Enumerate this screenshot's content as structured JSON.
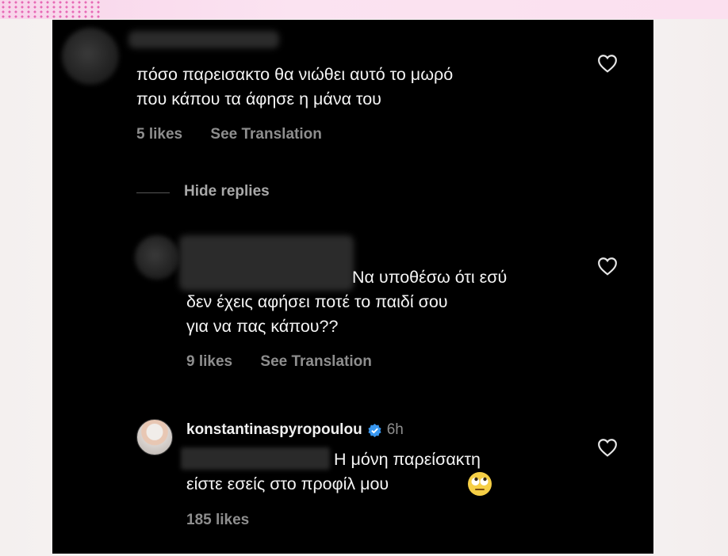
{
  "comments": [
    {
      "text_line1": "πόσο παρεισακτο θα νιώθει αυτό το μωρό",
      "text_line2": "που κάπου τα άφησε η μάνα του",
      "likes": "5 likes",
      "translate": "See Translation"
    },
    {
      "text_line1": "Να υποθέσω ότι εσύ",
      "text_line2": "δεν έχεις αφήσει ποτέ το παιδί σου",
      "text_line3": "για να πας κάπου??",
      "likes": "9 likes",
      "translate": "See Translation"
    },
    {
      "username": "konstantinaspyropoulou",
      "time": "6h",
      "text_line1": "Η μόνη παρείσακτη",
      "text_line2": "είστε εσείς στο προφίλ μου",
      "likes": "185 likes"
    }
  ],
  "hide_replies": "Hide replies",
  "icons": {
    "like": "heart-outline-icon",
    "verified": "verified-badge-icon",
    "emoji": "face-with-rolling-eyes-emoji"
  },
  "colors": {
    "panel_bg": "#000000",
    "meta_text": "#8e8e8e",
    "verified_blue": "#3897f0"
  }
}
